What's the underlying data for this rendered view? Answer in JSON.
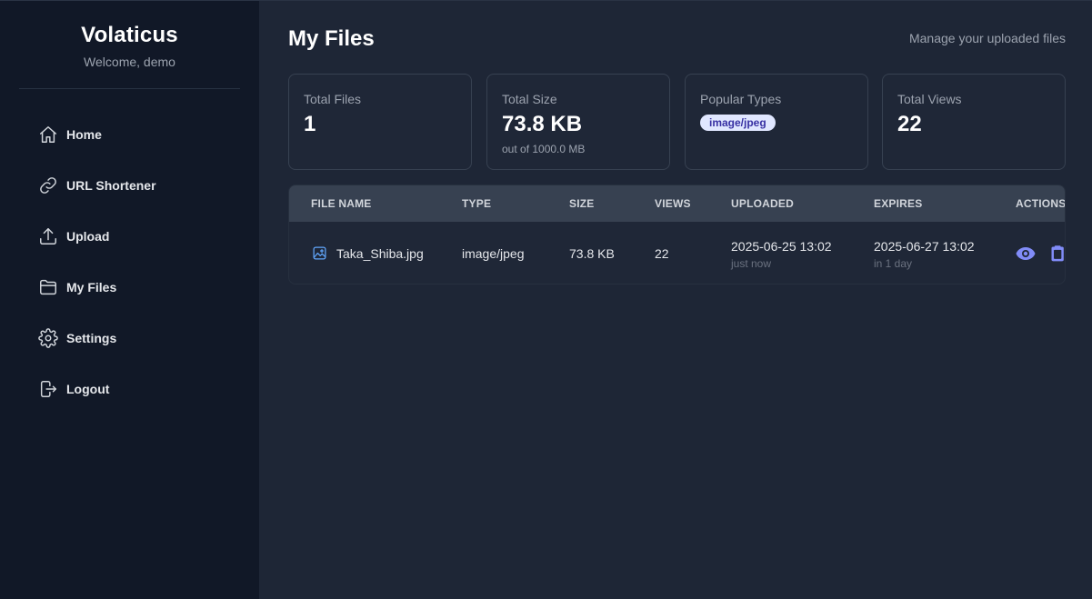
{
  "sidebar": {
    "brand": "Volaticus",
    "welcome": "Welcome, demo",
    "items": [
      {
        "label": "Home",
        "icon": "home-icon"
      },
      {
        "label": "URL Shortener",
        "icon": "link-icon"
      },
      {
        "label": "Upload",
        "icon": "upload-icon"
      },
      {
        "label": "My Files",
        "icon": "folder-icon"
      },
      {
        "label": "Settings",
        "icon": "gear-icon"
      },
      {
        "label": "Logout",
        "icon": "logout-icon"
      }
    ]
  },
  "header": {
    "title": "My Files",
    "subtitle": "Manage your uploaded files"
  },
  "stats": [
    {
      "label": "Total Files",
      "value": "1"
    },
    {
      "label": "Total Size",
      "value": "73.8 KB",
      "note": "out of 1000.0 MB"
    },
    {
      "label": "Popular Types",
      "badge": "image/jpeg"
    },
    {
      "label": "Total Views",
      "value": "22"
    }
  ],
  "table": {
    "columns": [
      "FILE NAME",
      "TYPE",
      "SIZE",
      "VIEWS",
      "UPLOADED",
      "EXPIRES",
      "ACTIONS"
    ],
    "rows": [
      {
        "name": "Taka_Shiba.jpg",
        "type": "image/jpeg",
        "size": "73.8 KB",
        "views": "22",
        "uploaded": "2025-06-25 13:02",
        "uploaded_rel": "just now",
        "expires": "2025-06-27 13:02",
        "expires_rel": "in 1 day",
        "actions": [
          "eye-icon",
          "clipboard-icon"
        ]
      }
    ]
  },
  "colors": {
    "sidebar_bg": "#111827",
    "main_bg": "#1e2636",
    "accent": "#818cf8",
    "badge_bg": "#e0e7ff",
    "badge_text": "#3730a3"
  }
}
